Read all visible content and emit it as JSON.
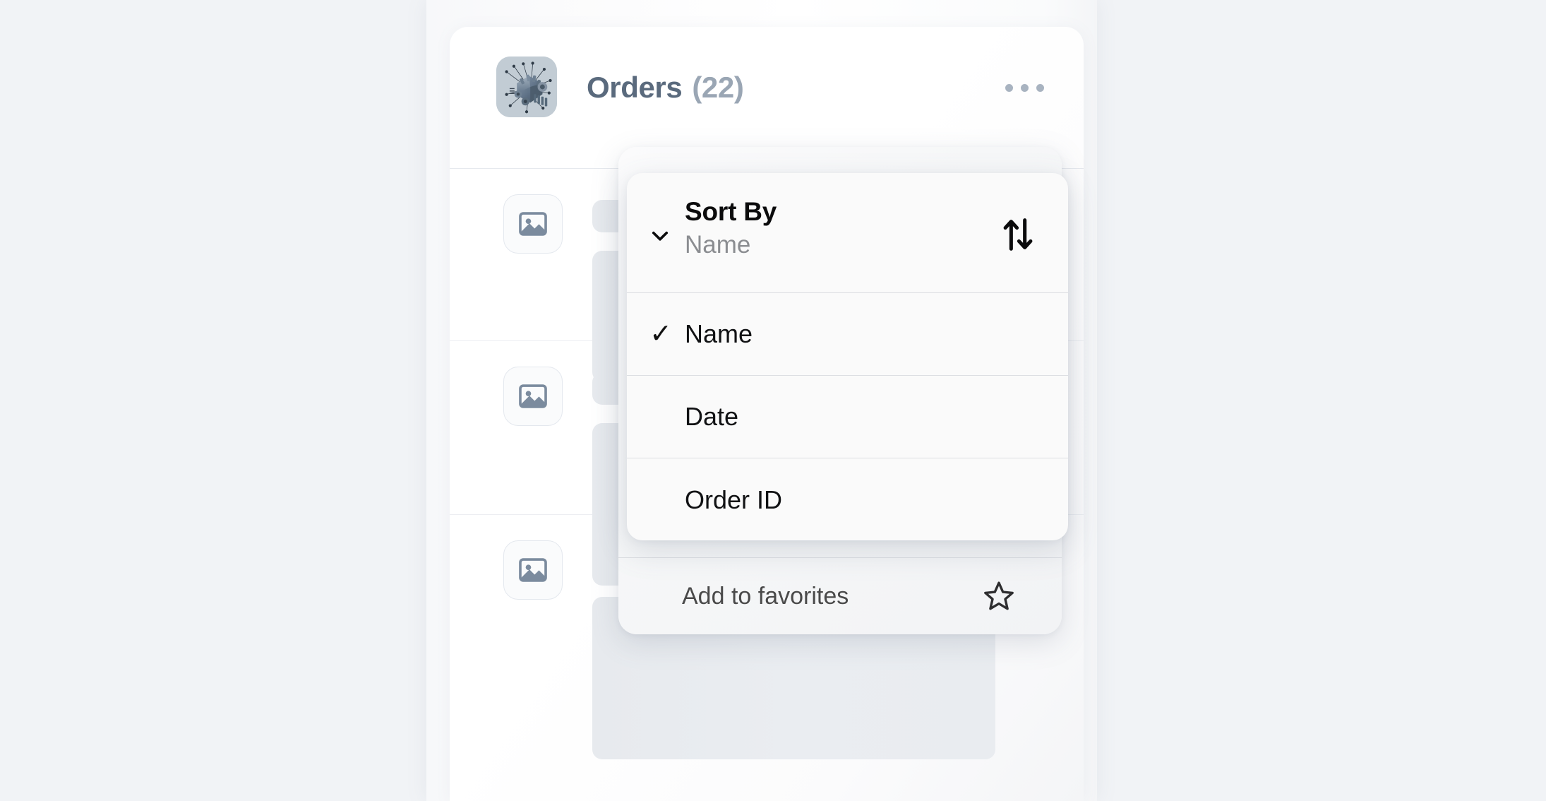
{
  "header": {
    "title": "Orders",
    "count": "(22)",
    "folder_icon": "machine-parts-icon",
    "more_icon": "more-options-icon"
  },
  "list": {
    "rows": [
      {
        "thumb_icon": "image-placeholder-icon"
      },
      {
        "thumb_icon": "image-placeholder-icon"
      },
      {
        "thumb_icon": "image-placeholder-icon"
      }
    ]
  },
  "context_menu": {
    "favorites": {
      "label": "Add to favorites",
      "icon": "star-outline-icon"
    }
  },
  "sort_dropdown": {
    "title": "Sort By",
    "selected_value": "Name",
    "chevron_icon": "chevron-down-icon",
    "direction_icon": "sort-up-down-icon",
    "check_glyph": "✓",
    "options": [
      {
        "label": "Name",
        "checked": true
      },
      {
        "label": "Date",
        "checked": false
      },
      {
        "label": "Order ID",
        "checked": false
      }
    ]
  },
  "colors": {
    "page_background": "#f1f3f6",
    "card_background": "#ffffff",
    "title_text": "#5a6a7d",
    "count_text": "#9aa6b4",
    "skeleton": "#e8ebef",
    "thumb_glyph": "#7b8b9e",
    "menu_background": "#fafafa",
    "divider": "#dcdee2"
  }
}
